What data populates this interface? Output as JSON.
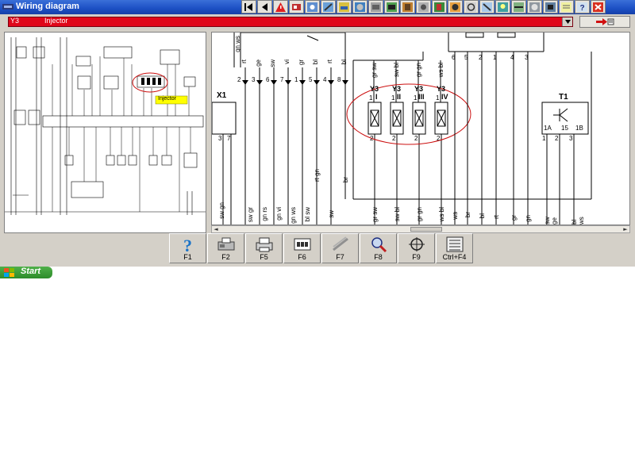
{
  "window": {
    "title": "Wiring diagram"
  },
  "selector": {
    "code": "Y3",
    "name": "Injector"
  },
  "overview": {
    "highlight_label": "Injector"
  },
  "detail": {
    "top_labels": [
      "gn ws"
    ],
    "wires_left": [
      {
        "color": "rt",
        "pin": "2"
      },
      {
        "color": "ge",
        "pin": "3"
      },
      {
        "color": "sw",
        "pin": "6"
      },
      {
        "color": "vi",
        "pin": "7"
      },
      {
        "color": "gr",
        "pin": "1"
      },
      {
        "color": "bl",
        "pin": "5"
      },
      {
        "color": "rt",
        "pin": "4"
      },
      {
        "color": "bl",
        "pin": "8"
      }
    ],
    "connector": {
      "id": "X1",
      "pin_left": "3",
      "pin_right": "7"
    },
    "injectors": [
      {
        "id": "Y3",
        "num": "I",
        "wire": "gr sw",
        "pin_top": "1",
        "pin_bottom": "2"
      },
      {
        "id": "Y3",
        "num": "II",
        "wire": "sw bl",
        "pin_top": "1",
        "pin_bottom": "2"
      },
      {
        "id": "Y3",
        "num": "III",
        "wire": "gr gn",
        "pin_top": "1",
        "pin_bottom": "2"
      },
      {
        "id": "Y3",
        "num": "IV",
        "wire": "ws bl",
        "pin_top": "1",
        "pin_bottom": "2"
      }
    ],
    "right_pins": [
      "6",
      "5",
      "2",
      "1",
      "4",
      "3"
    ],
    "transistor": {
      "id": "T1",
      "pins": [
        "1A",
        "15",
        "1B"
      ],
      "pins_bottom": [
        "1",
        "2",
        "3"
      ]
    },
    "bottom_wires": [
      "sw gn",
      "sw gr",
      "gn rs",
      "gn vi",
      "gn ws",
      "bl sw",
      "rt gn",
      "br",
      "sw",
      "gr sw",
      "sw bl",
      "gr gn",
      "ws bl",
      "ws",
      "br",
      "bl",
      "rt",
      "gr",
      "gn",
      "sw ge",
      "bl ws"
    ]
  },
  "fkeys": [
    {
      "label": "F1",
      "icon": "help-icon"
    },
    {
      "label": "F2",
      "icon": "fax-icon"
    },
    {
      "label": "F5",
      "icon": "printer-icon"
    },
    {
      "label": "F6",
      "icon": "connector-icon"
    },
    {
      "label": "F7",
      "icon": "tools-icon"
    },
    {
      "label": "F8",
      "icon": "magnifier-icon"
    },
    {
      "label": "F9",
      "icon": "target-icon"
    },
    {
      "label": "Ctrl+F4",
      "icon": "list-icon"
    }
  ],
  "taskbar": {
    "start_label": "Start"
  },
  "colors": {
    "titlebar": "#1c4fc4",
    "selector": "#e0071a",
    "highlight_oval": "#cc1010",
    "start": "#2d8c2a"
  }
}
